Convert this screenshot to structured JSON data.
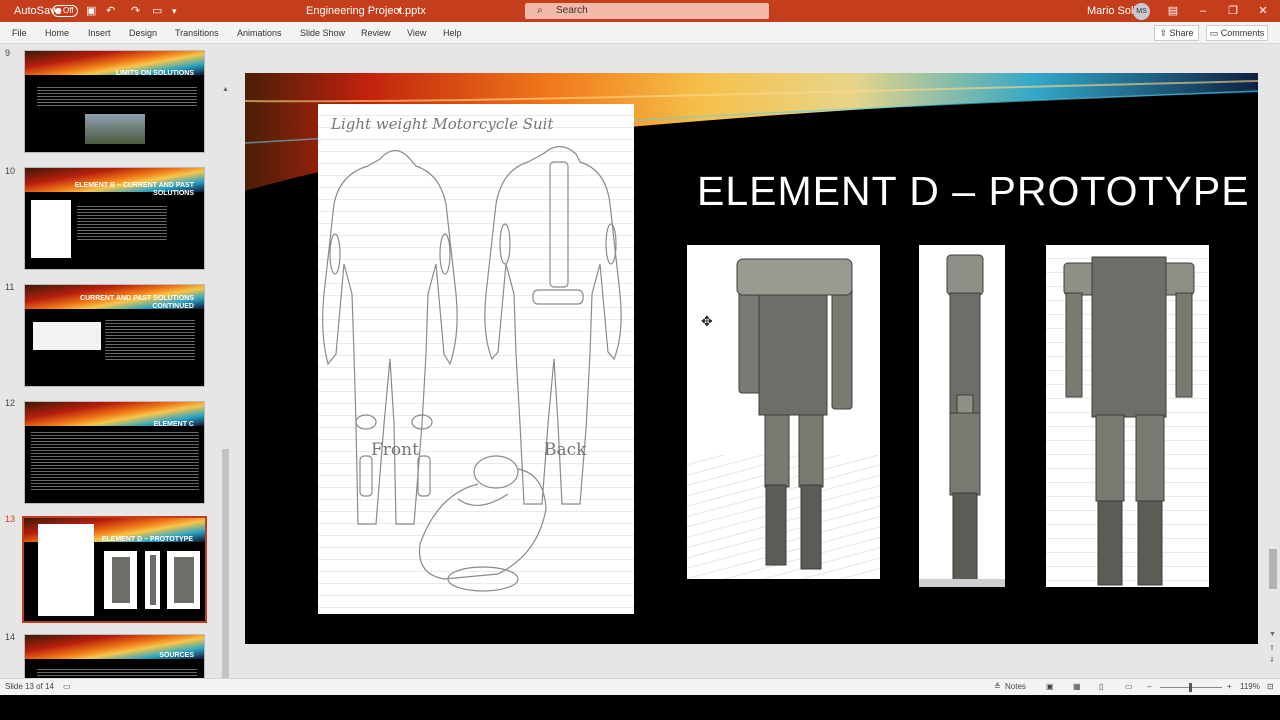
{
  "titlebar": {
    "autosave_label": "AutoSave",
    "autosave_state": "Off",
    "file_name": "Engineering Project.pptx",
    "search_placeholder": "Search",
    "user_name": "Mario Solis",
    "user_initials": "MS"
  },
  "menu": {
    "items": [
      "File",
      "Home",
      "Insert",
      "Design",
      "Transitions",
      "Animations",
      "Slide Show",
      "Review",
      "View",
      "Help"
    ],
    "share_label": "Share",
    "comments_label": "Comments"
  },
  "thumbnails": [
    {
      "number": "9",
      "title": "LIMITS ON SOLUTIONS"
    },
    {
      "number": "10",
      "title": "ELEMENT B – CURRENT AND PAST SOLUTIONS"
    },
    {
      "number": "11",
      "title": "CURRENT AND PAST SOLUTIONS CONTINUED"
    },
    {
      "number": "12",
      "title": "ELEMENT C"
    },
    {
      "number": "13",
      "title": "ELEMENT D – PROTOTYPE"
    },
    {
      "number": "14",
      "title": "SOURCES"
    }
  ],
  "slide": {
    "title": "ELEMENT D – PROTOTYPE",
    "sketch_caption": "Light weight Motorcycle Suit",
    "sketch_front_label": "Front",
    "sketch_back_label": "Back"
  },
  "statusbar": {
    "slide_indicator": "Slide 13 of 14",
    "notes_label": "Notes",
    "zoom_level": "119%"
  },
  "colors": {
    "accent": "#c43e1c",
    "thumb_active_border": "#c43e1c"
  }
}
